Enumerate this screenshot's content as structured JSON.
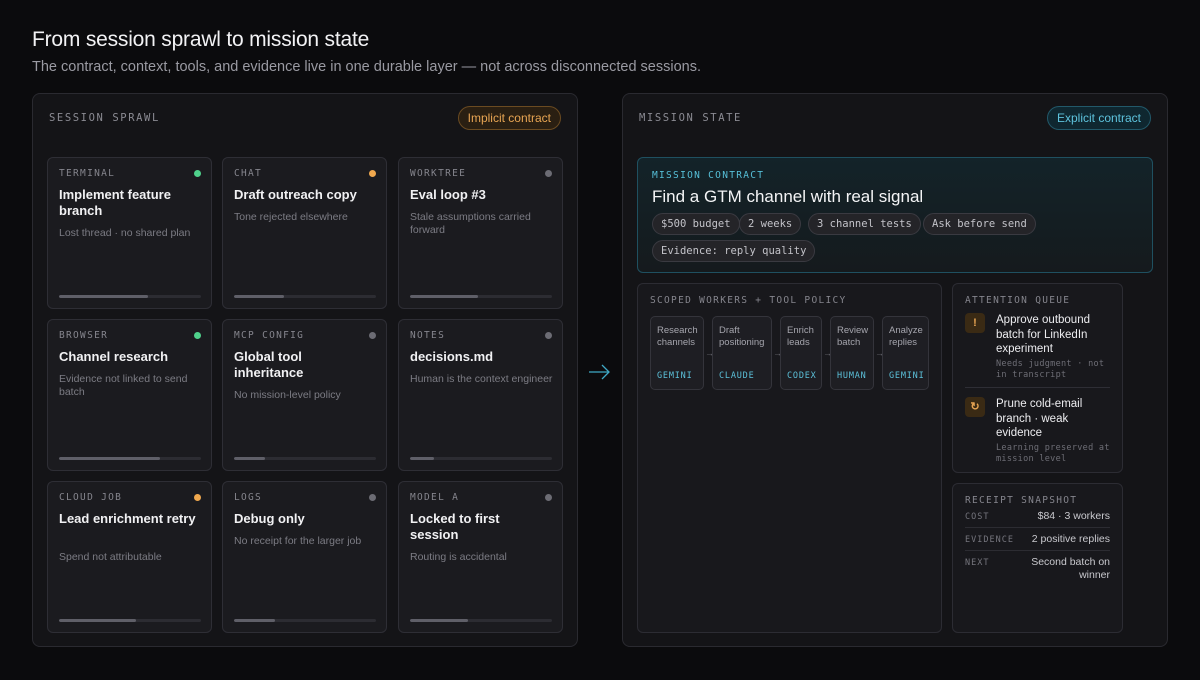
{
  "header": {
    "title": "From session sprawl to mission state",
    "subtitle": "The contract, context, tools, and evidence live in one durable layer — not across disconnected sessions."
  },
  "left_panel": {
    "label": "SESSION SPRAWL",
    "pill": "Implicit contract",
    "cards": [
      {
        "kind": "TERMINAL",
        "title": "Implement feature branch",
        "note": "Lost thread · no shared plan",
        "status_color": "#4fd18b",
        "progress": 0.63
      },
      {
        "kind": "CHAT",
        "title": "Draft outreach copy",
        "note": "Tone rejected elsewhere",
        "status_color": "#f0a84e",
        "progress": 0.35
      },
      {
        "kind": "WORKTREE",
        "title": "Eval loop #3",
        "note": "Stale assumptions carried forward",
        "status_color": "#6c6c74",
        "progress": 0.48
      },
      {
        "kind": "BROWSER",
        "title": "Channel research",
        "note": "Evidence not linked to send batch",
        "status_color": "#4fd18b",
        "progress": 0.71
      },
      {
        "kind": "MCP CONFIG",
        "title": "Global tool inheritance",
        "note": "No mission-level policy",
        "status_color": "#6c6c74",
        "progress": 0.22
      },
      {
        "kind": "NOTES",
        "title": "decisions.md",
        "note": "Human is the context engineer",
        "status_color": "#6c6c74",
        "progress": 0.17
      },
      {
        "kind": "CLOUD JOB",
        "title": "Lead enrichment retry",
        "note": "Spend not attributable",
        "status_color": "#f0a84e",
        "progress": 0.54
      },
      {
        "kind": "LOGS",
        "title": "Debug only",
        "note": "No receipt for the larger job",
        "status_color": "#6c6c74",
        "progress": 0.29
      },
      {
        "kind": "MODEL A",
        "title": "Locked to first session",
        "note": "Routing is accidental",
        "status_color": "#6c6c74",
        "progress": 0.41
      }
    ]
  },
  "right_panel": {
    "label": "MISSION STATE",
    "pill": "Explicit contract",
    "contract": {
      "label": "MISSION CONTRACT",
      "title": "Find a GTM channel with real signal",
      "chips": [
        "$500 budget",
        "2 weeks",
        "3 channel tests",
        "Ask before send",
        "Evidence: reply quality"
      ]
    },
    "workers": {
      "label": "SCOPED WORKERS + TOOL POLICY",
      "items": [
        {
          "task": "Research channels",
          "model": "GEMINI"
        },
        {
          "task": "Draft positioning",
          "model": "CLAUDE"
        },
        {
          "task": "Enrich leads",
          "model": "CODEX"
        },
        {
          "task": "Review batch",
          "model": "HUMAN"
        },
        {
          "task": "Analyze replies",
          "model": "GEMINI"
        }
      ]
    },
    "attention": {
      "label": "ATTENTION QUEUE",
      "items": [
        {
          "icon": "!",
          "icon_name": "alert-icon",
          "title": "Approve outbound batch for LinkedIn experiment",
          "note": "Needs judgment · not in transcript"
        },
        {
          "icon": "↻",
          "icon_name": "refresh-icon",
          "title": "Prune cold-email branch · weak evidence",
          "note": "Learning preserved at mission level"
        }
      ]
    },
    "receipt": {
      "label": "RECEIPT SNAPSHOT",
      "rows": [
        {
          "key": "COST",
          "value": "$84 · 3 workers"
        },
        {
          "key": "EVIDENCE",
          "value": "2 positive replies"
        },
        {
          "key": "NEXT",
          "value": "Second batch on winner"
        }
      ]
    }
  }
}
